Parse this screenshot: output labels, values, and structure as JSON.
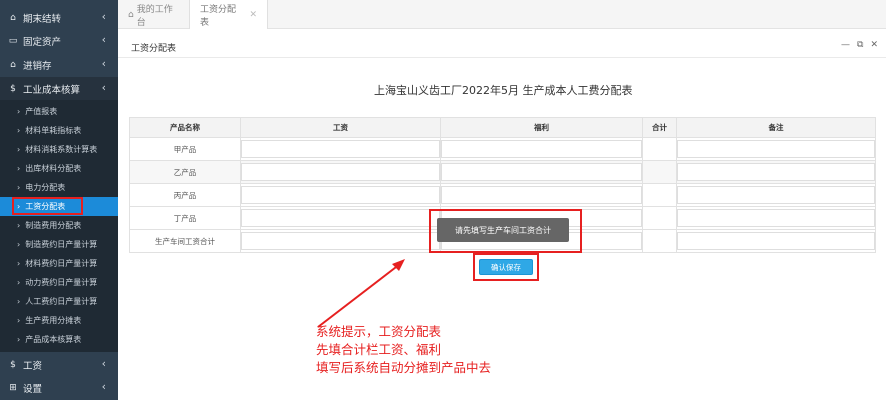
{
  "sidebar": {
    "sections": [
      {
        "icon": "home-icon",
        "glyph": "⌂",
        "label": "期末结转"
      },
      {
        "icon": "monitor-icon",
        "glyph": "▭",
        "label": "固定资产"
      },
      {
        "icon": "home-icon",
        "glyph": "⌂",
        "label": "进销存"
      },
      {
        "icon": "dollar-icon",
        "glyph": "$",
        "label": "工业成本核算"
      }
    ],
    "sub_items": [
      "产值报表",
      "材料单耗指标表",
      "材料消耗系数计算表",
      "出库材料分配表",
      "电力分配表",
      "工资分配表",
      "制造费用分配表",
      "制造费约日产量计算",
      "材料费约日产量计算",
      "动力费约日产量计算",
      "人工费约日产量计算",
      "生产费用分摊表",
      "产品成本核算表"
    ],
    "bottom_sections": [
      {
        "icon": "dollar-icon",
        "glyph": "$",
        "label": "工资"
      },
      {
        "icon": "grid-icon",
        "glyph": "⊞",
        "label": "设置"
      }
    ],
    "chevron": "‹",
    "sub_arrow": "›"
  },
  "tabs": {
    "home_label": "我的工作台",
    "current_label": "工资分配表",
    "close_glyph": "✕",
    "home_glyph": "⌂"
  },
  "panel": {
    "title": "工资分配表",
    "controls": [
      "—",
      "⧉",
      "✕"
    ]
  },
  "report": {
    "title": "上海宝山义齿工厂2022年5月 生产成本人工费分配表",
    "headers": [
      "产品名称",
      "工资",
      "福利",
      "合计",
      "备注"
    ],
    "rows": [
      "甲产品",
      "乙产品",
      "丙产品",
      "丁产品",
      "生产车间工资合计"
    ]
  },
  "alert": {
    "message": "请先填写生产车间工资合计"
  },
  "save_button": {
    "label": "确认保存"
  },
  "annotation": {
    "lines": [
      "系统提示，工资分配表",
      "先填合计栏工资、福利",
      "填写后系统自动分摊到产品中去"
    ]
  },
  "colors": {
    "sidebar_bg": "#2f4050",
    "active_item": "#1c8bd9",
    "highlight_red": "#e62020",
    "button_blue": "#2fa8e6"
  }
}
